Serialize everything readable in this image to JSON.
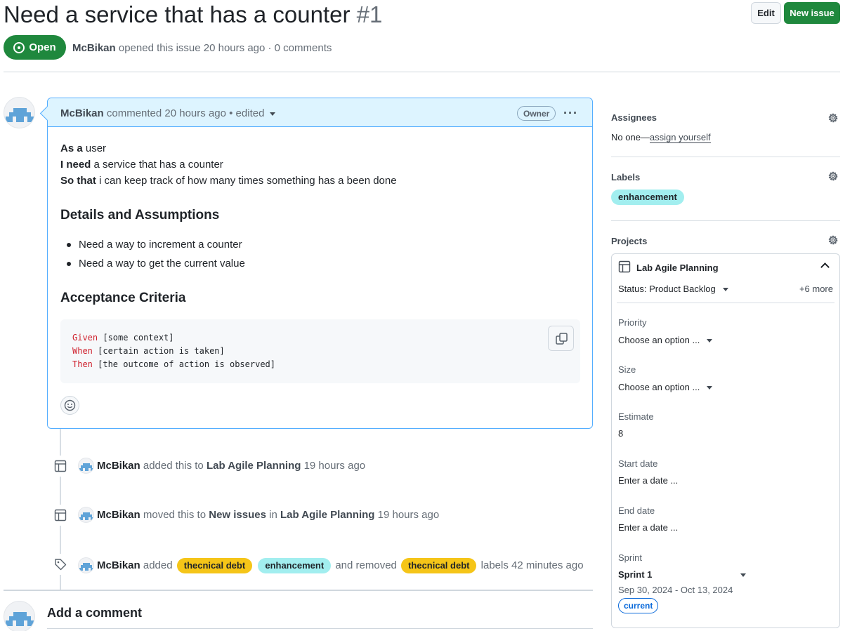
{
  "issue": {
    "title": "Need a service that has a counter",
    "number": "#1",
    "state": "Open",
    "author": "McBikan",
    "meta_text": "opened this issue 20 hours ago · 0 comments"
  },
  "actions": {
    "edit_label": "Edit",
    "new_issue_label": "New issue"
  },
  "comment": {
    "author": "McBikan",
    "meta": "commented 20 hours ago • edited",
    "badge": "Owner",
    "body_lines": [
      {
        "bold": "As a",
        "rest": " user"
      },
      {
        "bold": "I need",
        "rest": " a service that has a counter"
      },
      {
        "bold": "So that",
        "rest": " i can keep track of how many times something has a been done"
      }
    ],
    "details_heading": "Details and Assumptions",
    "details_items": [
      "Need a way to increment a counter",
      "Need a way to get the current value"
    ],
    "acceptance_heading": "Acceptance Criteria",
    "code_lines": [
      {
        "kw": "Given",
        "text": " [some context]"
      },
      {
        "kw": "When",
        "text": " [certain action is taken]"
      },
      {
        "kw": "Then",
        "text": " [the outcome of action is observed]"
      }
    ]
  },
  "timeline": [
    {
      "actor": "McBikan",
      "pre": "added this to",
      "target": "Lab Agile Planning",
      "time": "19 hours ago"
    },
    {
      "actor": "McBikan",
      "pre": "moved this to",
      "target": "New issues",
      "mid": "in",
      "target2": "Lab Agile Planning",
      "time": "19 hours ago"
    },
    {
      "actor": "McBikan",
      "pre": "added",
      "label1": "thecnical debt",
      "label2": "enhancement",
      "mid": "and removed",
      "label3": "thecnical debt",
      "post": "labels 42 minutes ago"
    }
  ],
  "labels_colors": {
    "tech_debt": "#f5c518",
    "enhancement": "#a2eeef"
  },
  "add_comment": "Add a comment",
  "sidebar": {
    "assignees_title": "Assignees",
    "assignees_text": "No one—",
    "assign_link": "assign yourself",
    "labels_title": "Labels",
    "label": "enhancement",
    "projects_title": "Projects",
    "project": {
      "name": "Lab Agile Planning",
      "status": "Status: Product Backlog",
      "more": "+6 more",
      "priority_label": "Priority",
      "priority_value": "Choose an option ...",
      "size_label": "Size",
      "size_value": "Choose an option ...",
      "estimate_label": "Estimate",
      "estimate_value": "8",
      "start_label": "Start date",
      "start_value": "Enter a date ...",
      "end_label": "End date",
      "end_value": "Enter a date ...",
      "sprint_label": "Sprint",
      "sprint_value": "Sprint 1",
      "sprint_dates": "Sep 30, 2024 - Oct 13, 2024",
      "sprint_badge": "current"
    }
  }
}
